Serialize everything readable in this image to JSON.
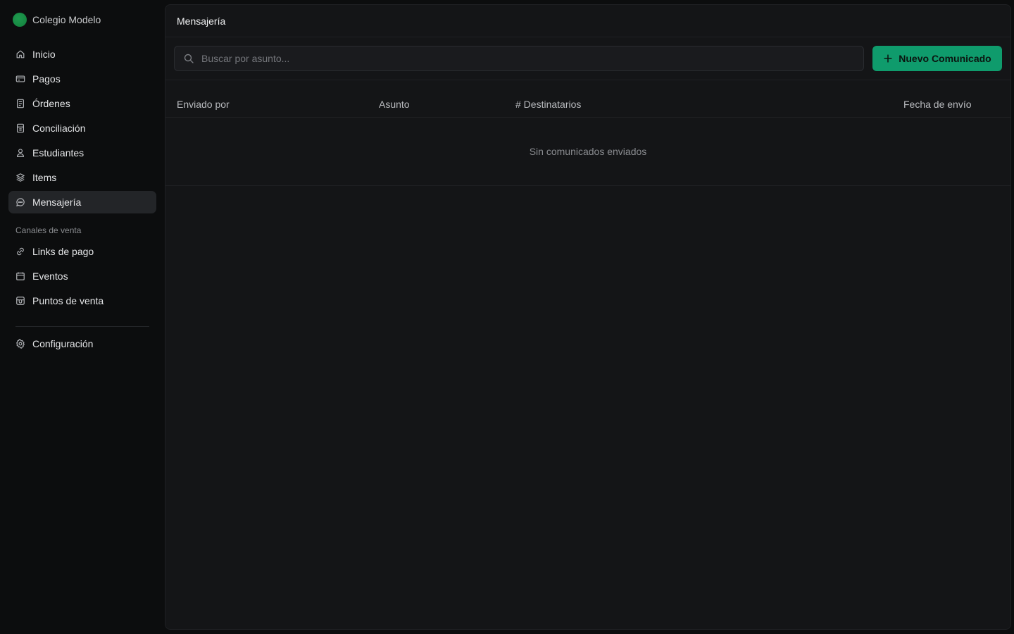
{
  "brand": {
    "name": "Colegio Modelo"
  },
  "sidebar": {
    "main_items": [
      {
        "label": "Inicio",
        "icon": "home-icon"
      },
      {
        "label": "Pagos",
        "icon": "credit-card-icon"
      },
      {
        "label": "Órdenes",
        "icon": "document-icon"
      },
      {
        "label": "Conciliación",
        "icon": "receipt-icon"
      },
      {
        "label": "Estudiantes",
        "icon": "user-icon"
      },
      {
        "label": "Items",
        "icon": "layers-icon"
      },
      {
        "label": "Mensajería",
        "icon": "chat-icon",
        "active": true
      }
    ],
    "section_label": "Canales de venta",
    "channel_items": [
      {
        "label": "Links de pago",
        "icon": "link-icon"
      },
      {
        "label": "Eventos",
        "icon": "calendar-icon"
      },
      {
        "label": "Puntos de venta",
        "icon": "store-icon"
      }
    ],
    "config_item": {
      "label": "Configuración",
      "icon": "gear-icon"
    }
  },
  "main": {
    "title": "Mensajería",
    "search": {
      "placeholder": "Buscar por asunto...",
      "value": ""
    },
    "new_button": {
      "label": "Nuevo Comunicado",
      "icon": "plus-icon"
    },
    "table": {
      "columns": [
        "Enviado por",
        "Asunto",
        "# Destinatarios",
        "Fecha de envío"
      ],
      "empty_message": "Sin comunicados enviados"
    }
  },
  "colors": {
    "accent": "#0f9b6c",
    "background": "#0c0d0e",
    "panel": "#141517"
  }
}
